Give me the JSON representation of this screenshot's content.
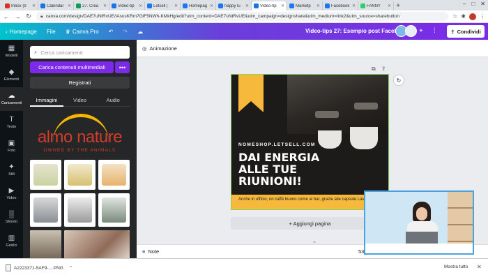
{
  "browser": {
    "tabs": [
      {
        "title": "Inbox (9",
        "color": "#d93025"
      },
      {
        "title": "Calendar",
        "color": "#1a73e8"
      },
      {
        "title": "27. Crea",
        "color": "#0f9d58"
      },
      {
        "title": "Video-tip",
        "color": "#1a73e8"
      },
      {
        "title": "Letsell |",
        "color": "#1877f2"
      },
      {
        "title": "Homepag",
        "color": "#1877f2"
      },
      {
        "title": "happy lu",
        "color": "#1877f2"
      },
      {
        "title": "Video-tip",
        "color": "#1a73e8"
      },
      {
        "title": "Marketp",
        "color": "#1877f2"
      },
      {
        "title": "Facebook",
        "color": "#1877f2"
      },
      {
        "title": "FANNY",
        "color": "#25d366"
      }
    ],
    "new_tab": "+",
    "window_controls": [
      "–",
      "□",
      "✕"
    ],
    "url": "canva.com/design/DAE7uNtRvUE/iAsusKRm7GlF5NWh-KMkHg/edit?utm_content=DAE7uNtRvUE&utm_campaign=designshare&utm_medium=link2&utm_source=sharebutton"
  },
  "canva_header": {
    "home": "Homepage",
    "file": "File",
    "pro": "Canva Pro",
    "doc_title": "Video-tips 27: Esempio post Facebook",
    "share": "Condividi"
  },
  "rail": [
    {
      "label": "Modelli",
      "icon": "▦"
    },
    {
      "label": "Elementi",
      "icon": "◆"
    },
    {
      "label": "Caricamenti",
      "icon": "☁"
    },
    {
      "label": "Testo",
      "icon": "T"
    },
    {
      "label": "Foto",
      "icon": "▣"
    },
    {
      "label": "Stili",
      "icon": "✦"
    },
    {
      "label": "Video",
      "icon": "▶"
    },
    {
      "label": "Sfondo",
      "icon": "▒"
    },
    {
      "label": "Grafici",
      "icon": "▥"
    }
  ],
  "panel": {
    "search_placeholder": "Cerca caricamenti",
    "upload_button": "Carica contenuti multimediali",
    "more": "•••",
    "record_button": "Registrati",
    "tabs": [
      "Immagini",
      "Video",
      "Audio"
    ],
    "brand_name": "almo nature",
    "brand_tagline": "OWNED BY THE ANIMALS"
  },
  "editor": {
    "animation": "Animazione",
    "add_page": "+ Aggiungi pagina",
    "notes": "Note",
    "page_number": "53"
  },
  "design": {
    "site": "NOMESHOP.LETSELL.COM",
    "headline": "DAI ENERGIA ALLE TUE RIUNIONI!",
    "footer": "Anche in ufficio, un caffè buono come al bar, grazie alle capsule Lavazza!"
  },
  "downloads": {
    "file": "A2223371-5AF9-....PNG",
    "show_all": "Mostra tutto"
  }
}
